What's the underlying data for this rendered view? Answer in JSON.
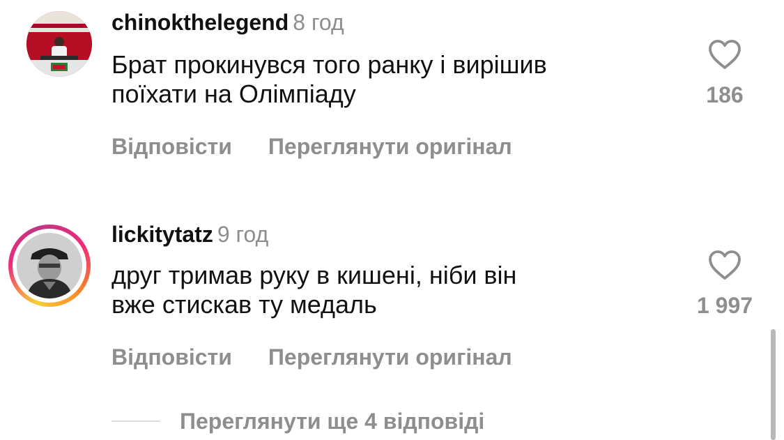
{
  "comments": [
    {
      "username": "chinokthelegend",
      "time": "8 год",
      "text_line1": "Брат прокинувся того ранку і вирішив",
      "text_line2": "поїхати на Олімпіаду",
      "likes": "186",
      "reply_label": "Відповісти",
      "translate_label": "Переглянути оригінал",
      "has_story_ring": false
    },
    {
      "username": "lickitytatz",
      "time": "9 год",
      "text_line1": "друг тримав руку в кишені, ніби він",
      "text_line2": "вже стискав ту медаль",
      "likes": "1 997",
      "reply_label": "Відповісти",
      "translate_label": "Переглянути оригінал",
      "has_story_ring": true
    }
  ],
  "more_replies_label": "Переглянути ще 4 відповіді",
  "icons": {
    "like": "heart-outline-icon"
  },
  "colors": {
    "text": "#111111",
    "secondary": "#8e8e8e",
    "story_ring": [
      "#f9ce34",
      "#ee2a7b",
      "#c13584"
    ]
  }
}
